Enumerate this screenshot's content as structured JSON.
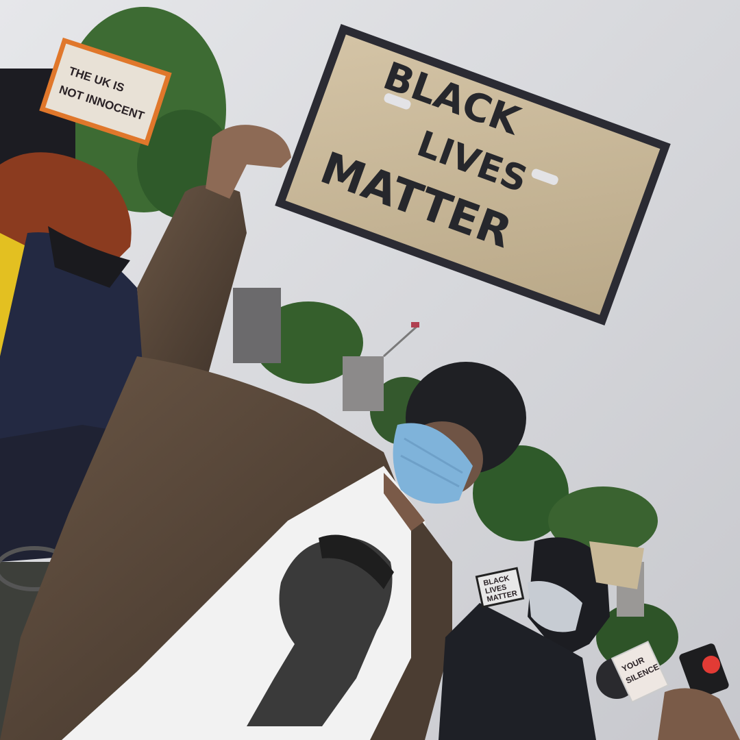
{
  "scene": {
    "main_sign": {
      "line1": "BLACK",
      "line2": "LIVES",
      "line3": "MATTER"
    },
    "small_sign_left": {
      "line1": "THE UK IS",
      "line2": "NOT INNOCENT"
    },
    "small_sign_right": {
      "line1": "YOUR",
      "line2": "SILENCE"
    },
    "far_sign": {
      "line1": "BLACK",
      "line2": "LIVES",
      "line3": "MATTER"
    },
    "colors": {
      "sky": "#d9dade",
      "cardboard": "#c9b89b",
      "sign_border": "#2b2b33",
      "jacket": "#5a4a3c",
      "shirt": "#f2f2f2",
      "mask": "#7fb3da",
      "beanie": "#1f2024",
      "trees": "#2f5a2a"
    }
  }
}
